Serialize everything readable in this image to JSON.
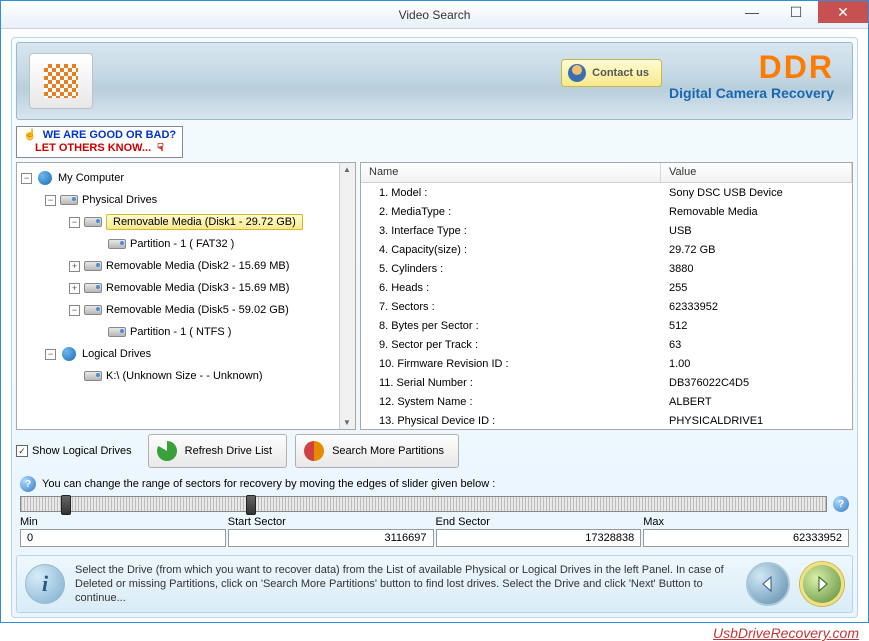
{
  "window": {
    "title": "Video Search"
  },
  "banner": {
    "contact_label": "Contact us",
    "brand_ddr": "DDR",
    "brand_sub": "Digital Camera Recovery"
  },
  "promo": {
    "line1": "WE ARE GOOD OR BAD?",
    "line2": "LET OTHERS KNOW..."
  },
  "tree": {
    "root": "My Computer",
    "physical": "Physical Drives",
    "sel": "Removable Media (Disk1 - 29.72 GB)",
    "part_fat": "Partition - 1 ( FAT32 )",
    "d2": "Removable Media (Disk2 - 15.69 MB)",
    "d3": "Removable Media (Disk3 - 15.69 MB)",
    "d5": "Removable Media (Disk5 - 59.02 GB)",
    "part_ntfs": "Partition - 1 ( NTFS )",
    "logical": "Logical Drives",
    "k": "K:\\ (Unknown Size  -  - Unknown)"
  },
  "props": {
    "header_name": "Name",
    "header_value": "Value",
    "rows": [
      {
        "n": "1. Model :",
        "v": "Sony DSC USB Device"
      },
      {
        "n": "2. MediaType :",
        "v": "Removable Media"
      },
      {
        "n": "3. Interface Type :",
        "v": "USB"
      },
      {
        "n": "4. Capacity(size) :",
        "v": "29.72 GB"
      },
      {
        "n": "5. Cylinders :",
        "v": "3880"
      },
      {
        "n": "6. Heads :",
        "v": "255"
      },
      {
        "n": "7. Sectors :",
        "v": "62333952"
      },
      {
        "n": "8. Bytes per Sector :",
        "v": "512"
      },
      {
        "n": "9. Sector per Track :",
        "v": "63"
      },
      {
        "n": "10. Firmware Revision ID :",
        "v": "1.00"
      },
      {
        "n": "11. Serial Number :",
        "v": "DB376022C4D5"
      },
      {
        "n": "12. System Name :",
        "v": "ALBERT"
      },
      {
        "n": "13. Physical Device ID :",
        "v": "PHYSICALDRIVE1"
      }
    ]
  },
  "controls": {
    "show_logical": "Show Logical Drives",
    "refresh": "Refresh Drive List",
    "search_more": "Search More Partitions"
  },
  "range": {
    "caption": "You can change the range of sectors for recovery by moving the edges of slider given below :",
    "min_label": "Min",
    "min_val": "0",
    "start_label": "Start Sector",
    "start_val": "3116697",
    "end_label": "End Sector",
    "end_val": "17328838",
    "max_label": "Max",
    "max_val": "62333952"
  },
  "info_text": "Select the Drive (from which you want to recover data) from the List of available Physical or Logical Drives in the left Panel. In case of Deleted or missing Partitions, click on 'Search More Partitions' button to find lost drives. Select the Drive and click 'Next' Button to continue...",
  "footer_link": "UsbDriveRecovery.com"
}
